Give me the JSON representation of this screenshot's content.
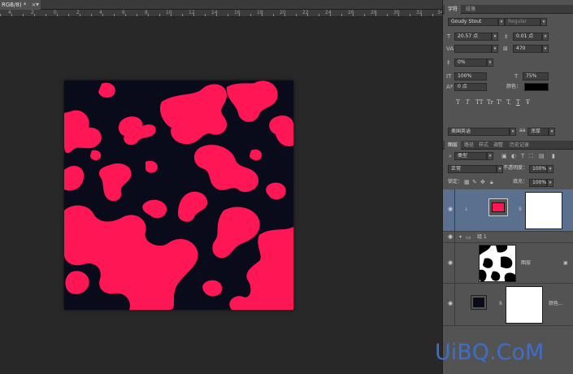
{
  "document": {
    "tab_label": "RGB/8) *",
    "close_glyph": "×",
    "add_glyph": "▾"
  },
  "ruler": {
    "marks": [
      "4",
      "2",
      "0",
      "2",
      "4",
      "6",
      "8",
      "10",
      "12",
      "14",
      "16",
      "18",
      "20",
      "22",
      "24",
      "26",
      "28",
      "30",
      "32",
      "34",
      "36",
      "38"
    ]
  },
  "canvas": {
    "background_color": "#0a0b1a",
    "blob_color": "#ff1755"
  },
  "char_panel": {
    "tabs": [
      "字符",
      "段落"
    ],
    "font_family": "Goudy Stout",
    "font_style": "Regular",
    "font_size": "20.57 点",
    "leading": "0.01 点",
    "kerning": "",
    "tracking": "470",
    "baseline_scale": "0%",
    "vertical_scale": "100%",
    "horizontal_scale": "75%",
    "baseline_shift": "0 点",
    "color_label": "颜色：",
    "color_value": "#000000",
    "style_buttons": [
      "T",
      "T",
      "TT",
      "Tr",
      "T'",
      "T,",
      "T",
      "Ŧ"
    ],
    "language": "美国英语",
    "aa_label": "aa",
    "antialias": "浑厚"
  },
  "layers_panel": {
    "tabs": [
      "图层",
      "路径",
      "样式",
      "调整",
      "历史记录"
    ],
    "filter_kind": "类型",
    "blend_mode": "正常",
    "opacity_label": "不透明度：",
    "opacity_value": "100%",
    "lock_label": "锁定：",
    "fill_label": "填充：",
    "fill_value": "100%",
    "group_name": "组 1",
    "layer_pattern_name": "图层",
    "layer_fill_name": "颜色..."
  },
  "watermark": "UiBQ.CoM"
}
